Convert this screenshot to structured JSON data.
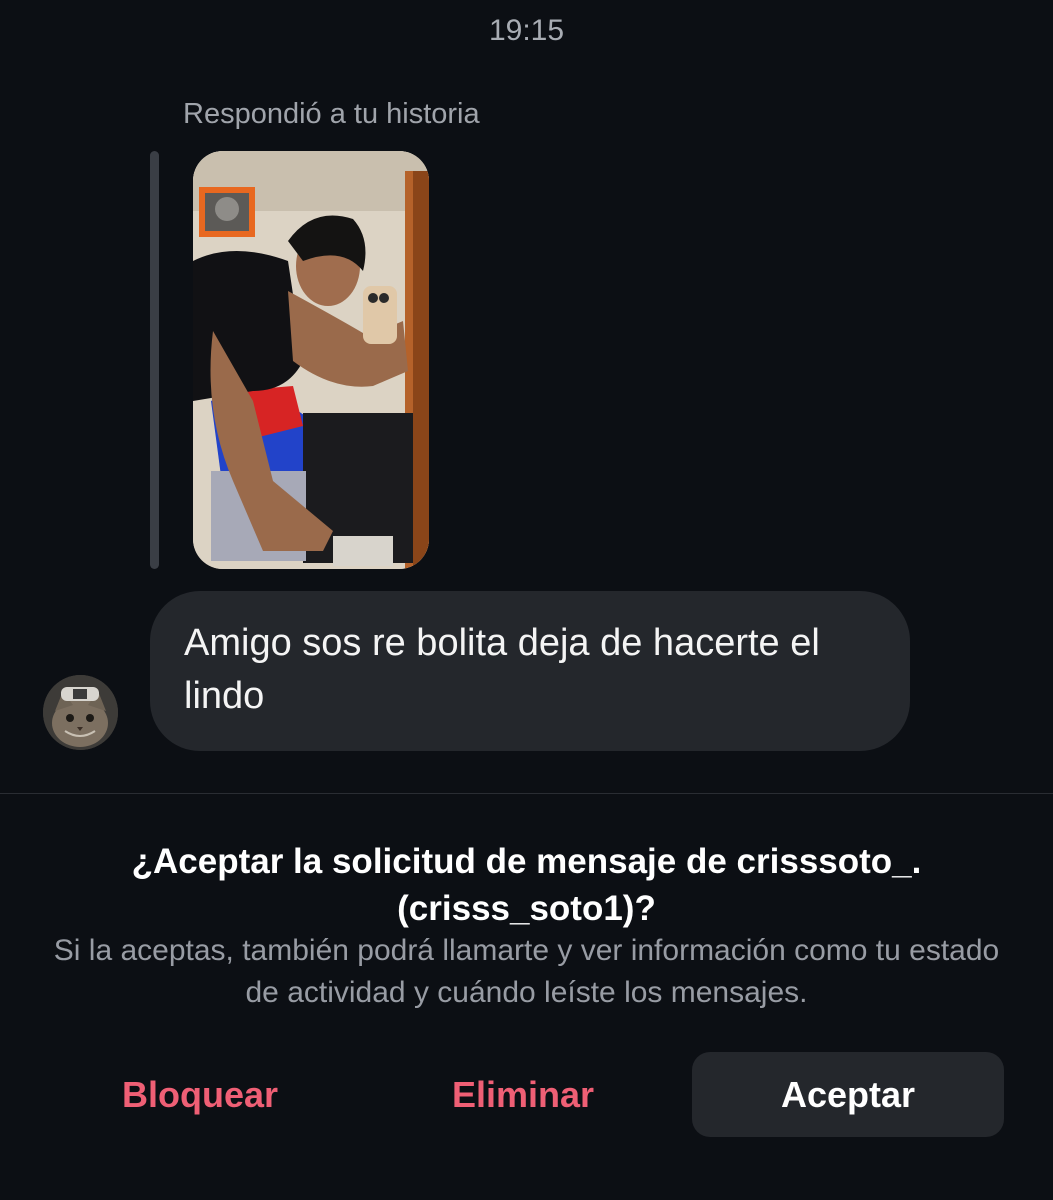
{
  "chat": {
    "timestamp": "19:15",
    "reply_label": "Respondió a tu historia",
    "message_text": "Amigo sos re bolita deja de hacerte el lindo"
  },
  "request": {
    "title": "¿Aceptar la solicitud de mensaje de crisssoto_. (crisss_soto1)?",
    "description": "Si la aceptas, también podrá llamarte y ver información como tu estado de actividad y cuándo leíste los mensajes."
  },
  "actions": {
    "block_label": "Bloquear",
    "delete_label": "Eliminar",
    "accept_label": "Aceptar"
  },
  "colors": {
    "background": "#0c0f14",
    "bubble": "#24272c",
    "destructive": "#ef5f75"
  }
}
